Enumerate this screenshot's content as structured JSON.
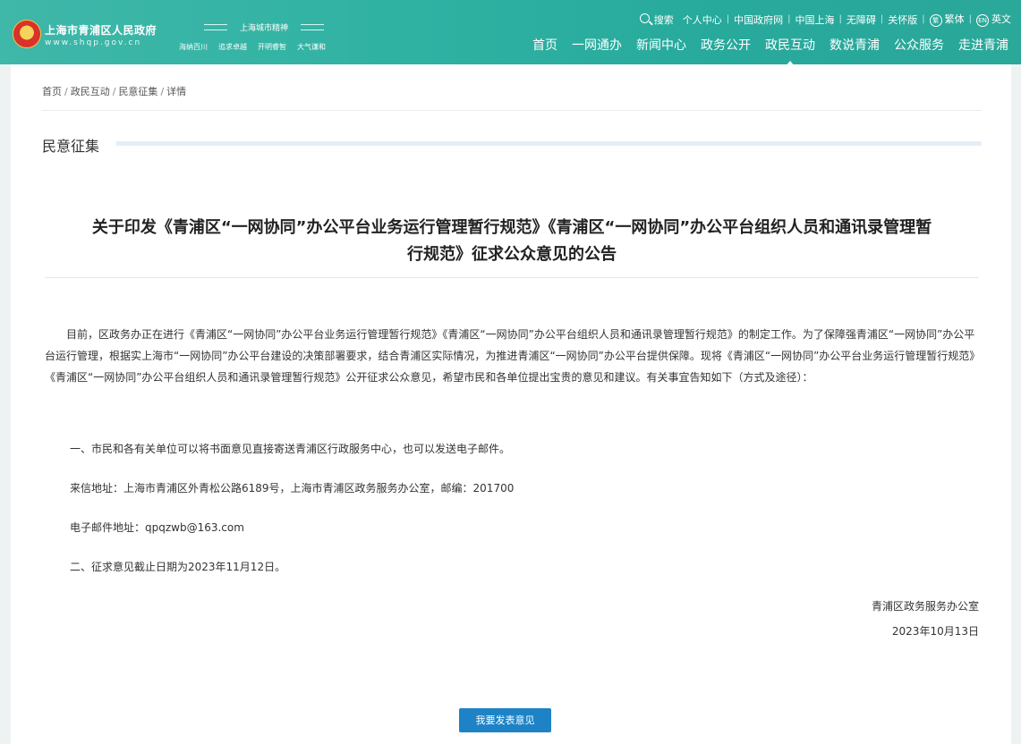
{
  "header": {
    "site_title": "上海市青浦区人民政府",
    "site_url": "www.shqp.gov.cn",
    "spirit_title": "上海城市精神",
    "spirit_words": [
      "海纳百川",
      "追求卓越",
      "开明睿智",
      "大气谦和"
    ],
    "top_links": [
      "搜索",
      "个人中心",
      "中国政府网",
      "中国上海",
      "无障碍",
      "关怀版",
      "繁体",
      "英文"
    ],
    "nav": [
      "首页",
      "一网通办",
      "新闻中心",
      "政务公开",
      "政民互动",
      "数说青浦",
      "公众服务",
      "走进青浦"
    ],
    "active_nav": "政民互动",
    "colors": {
      "header_bg": "#2fb2a2",
      "button_blue": "#1d83c6"
    }
  },
  "breadcrumb": [
    "首页",
    "政民互动",
    "民意征集",
    "详情"
  ],
  "section": {
    "title": "民意征集"
  },
  "article": {
    "title_line1": "关于印发《青浦区“一网协同”办公平台业务运行管理暂行规范》《青浦区“一网协同”办公平台组织人员和通讯录管理暂",
    "title_line2": "行规范》征求公众意见的公告",
    "para1": "目前，区政务办正在进行《青浦区“一网协同”办公平台业务运行管理暂行规范》《青浦区“一网协同”办公平台组织人员和通讯录管理暂行规范》的制定工作。为了保障强青浦区“一网协同”办公平台运行管理，根据实上海市“一网协同”办公平台建设的决策部署要求，结合青浦区实际情况，为推进青浦区“一网协同”办公平台提供保障。现将《青浦区“一网协同”办公平台业务运行管理暂行规范》《青浦区“一网协同”办公平台组织人员和通讯录管理暂行规范》公开征求公众意见，希望市民和各单位提出宝贵的意见和建议。有关事宜告知如下（方式及途径）：",
    "item1": "一、市民和各有关单位可以将书面意见直接寄送青浦区行政服务中心，也可以发送电子邮件。",
    "address": "来信地址：上海市青浦区外青松公路6189号，上海市青浦区政务服务办公室，邮编：201700",
    "email": "电子邮件地址：qpqzwb@163.com",
    "item2": "二、征求意见截止日期为2023年11月12日。",
    "signer": "青浦区政务服务办公室",
    "date": "2023年10月13日"
  },
  "submit_button": "我要发表意见"
}
